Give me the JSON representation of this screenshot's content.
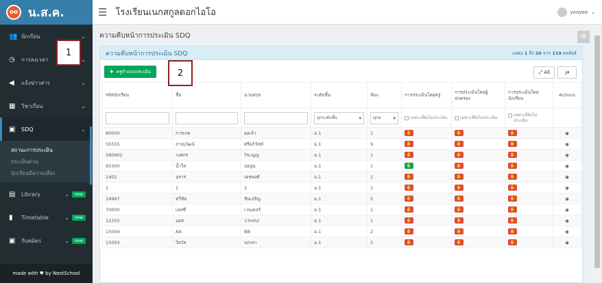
{
  "logo": {
    "icon_text": "oo",
    "text": "น.ส.ค."
  },
  "sidebar": {
    "items": [
      {
        "label": "นักเรียน",
        "icon": "users-icon"
      },
      {
        "label": "การลงเวลา",
        "icon": "clock-icon"
      },
      {
        "label": "แจ้งข่าวสาร",
        "icon": "bullhorn-icon"
      },
      {
        "label": "วิชาเรียน",
        "icon": "calendar-icon"
      },
      {
        "label": "SDQ",
        "icon": "clipboard-icon"
      }
    ],
    "sdq_sub": [
      "สถานะการประเมิน",
      "ประเมินด่วน",
      "นักเรียนมีความเสี่ยง"
    ],
    "extra": [
      {
        "label": "Library",
        "badge": "new"
      },
      {
        "label": "Timetable",
        "badge": "new"
      },
      {
        "label": "รับสมัคร",
        "badge": "new"
      }
    ],
    "footer": "made with ♥ by NextSchool"
  },
  "header": {
    "school": "โรงเรียนเนกสกูลดอกไอโอ",
    "user": "yooyee"
  },
  "page": {
    "title": "ความคืบหน้าการประเมิน SDQ"
  },
  "box": {
    "title": "ความคืบหน้าการประเมิน SDQ",
    "records_pre": "แสดง",
    "records_from": "1",
    "records_mid": "ถึง",
    "records_to": "20",
    "records_of": "จาก",
    "records_total": "119",
    "records_post": "ผลลัพธ์",
    "add_button": "ครูทำแบบประเมิน",
    "all_button": "All"
  },
  "table": {
    "headers": [
      "รหัสนักเรียน",
      "ชื่อ",
      "นามสกุล",
      "ระดับชั้น",
      "ห้อง",
      "การประเมินโดยครู",
      "การประเมินโดยผู้ปกครอง",
      "การประเมินโดยนักเรียน",
      "Actions"
    ],
    "filters": {
      "level": "ทุกระดับชั้น",
      "room": "ทุกห",
      "check": "เฉพาะที่ยังไม่ประเมิน"
    },
    "rows": [
      {
        "id": "80000",
        "name": "การเกด",
        "surname": "ออเจ้า",
        "level": "ม.1",
        "room": "1",
        "t": "red",
        "p": "red",
        "s": "red"
      },
      {
        "id": "55555",
        "name": "ภาณุวัฒน์",
        "surname": "ศรีอภิวัทท์",
        "level": "ม.1",
        "room": "9",
        "t": "red",
        "p": "red",
        "s": "red"
      },
      {
        "id": "580902",
        "name": "วงศกร",
        "surname": "วิระญญ",
        "level": "ม.1",
        "room": "1",
        "t": "red",
        "p": "red",
        "s": "red"
      },
      {
        "id": "65300",
        "name": "น้ำใส",
        "surname": "ปอปูน",
        "level": "ม.1",
        "room": "1",
        "t": "green",
        "p": "red",
        "s": "red"
      },
      {
        "id": "1402",
        "name": "นราร",
        "surname": "เดชพงศ์",
        "level": "ม.1",
        "room": "1",
        "t": "red",
        "p": "red",
        "s": "red"
      },
      {
        "id": "1",
        "name": "1",
        "surname": "2",
        "level": "ม.1",
        "room": "1",
        "t": "red",
        "p": "red",
        "s": "red"
      },
      {
        "id": "14997",
        "name": "ทวีชัย",
        "surname": "ชินเจริญ",
        "level": "ม.1",
        "room": "5",
        "t": "red",
        "p": "red",
        "s": "red"
      },
      {
        "id": "70000",
        "name": "เอฟซี",
        "surname": "เวนเดอร์",
        "level": "ม.1",
        "room": "1",
        "t": "red",
        "p": "red",
        "s": "red"
      },
      {
        "id": "12355",
        "name": "บอส",
        "surname": "13mhz",
        "level": "ม.1",
        "room": "1",
        "t": "red",
        "p": "red",
        "s": "red"
      },
      {
        "id": "15004",
        "name": "AA",
        "surname": "BB",
        "level": "ม.1",
        "room": "2",
        "t": "red",
        "p": "red",
        "s": "red"
      },
      {
        "id": "15003",
        "name": "วิทวัส",
        "surname": "นกเขา",
        "level": "ม.1",
        "room": "2",
        "t": "red",
        "p": "red",
        "s": "red"
      }
    ]
  },
  "annotations": [
    "1",
    "2"
  ]
}
